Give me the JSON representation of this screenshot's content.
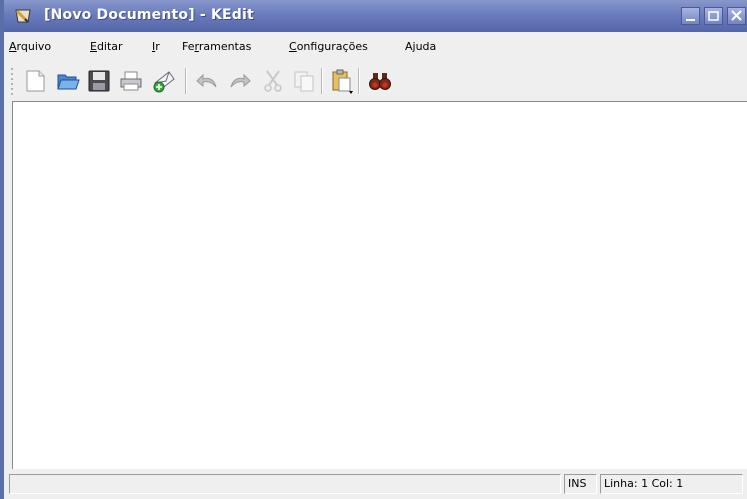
{
  "window": {
    "title": "[Novo Documento] - KEdit"
  },
  "menu": [
    {
      "pre": "",
      "u": "A",
      "post": "rquivo"
    },
    {
      "pre": "",
      "u": "E",
      "post": "ditar"
    },
    {
      "pre": "",
      "u": "I",
      "post": "r"
    },
    {
      "pre": "Fe",
      "u": "r",
      "post": "ramentas"
    },
    {
      "pre": "",
      "u": "C",
      "post": "onfigurações"
    },
    {
      "pre": "",
      "u": "",
      "post": "Ajuda"
    }
  ],
  "toolbar": {
    "icons": [
      "new-document-icon",
      "open-folder-icon",
      "save-floppy-icon",
      "print-icon",
      "send-mail-icon",
      "undo-icon",
      "redo-icon",
      "cut-icon",
      "copy-icon",
      "paste-icon",
      "find-binoculars-icon"
    ]
  },
  "editor": {
    "content": ""
  },
  "status": {
    "message": "",
    "mode": "INS",
    "position": "Linha: 1 Col: 1"
  }
}
